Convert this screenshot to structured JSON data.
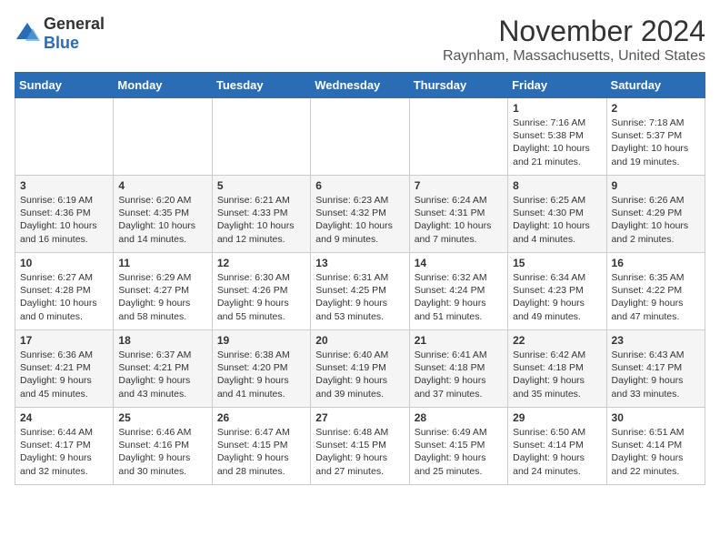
{
  "logo": {
    "general": "General",
    "blue": "Blue"
  },
  "header": {
    "month": "November 2024",
    "location": "Raynham, Massachusetts, United States"
  },
  "days_of_week": [
    "Sunday",
    "Monday",
    "Tuesday",
    "Wednesday",
    "Thursday",
    "Friday",
    "Saturday"
  ],
  "weeks": [
    [
      {
        "day": "",
        "info": ""
      },
      {
        "day": "",
        "info": ""
      },
      {
        "day": "",
        "info": ""
      },
      {
        "day": "",
        "info": ""
      },
      {
        "day": "",
        "info": ""
      },
      {
        "day": "1",
        "info": "Sunrise: 7:16 AM\nSunset: 5:38 PM\nDaylight: 10 hours and 21 minutes."
      },
      {
        "day": "2",
        "info": "Sunrise: 7:18 AM\nSunset: 5:37 PM\nDaylight: 10 hours and 19 minutes."
      }
    ],
    [
      {
        "day": "3",
        "info": "Sunrise: 6:19 AM\nSunset: 4:36 PM\nDaylight: 10 hours and 16 minutes."
      },
      {
        "day": "4",
        "info": "Sunrise: 6:20 AM\nSunset: 4:35 PM\nDaylight: 10 hours and 14 minutes."
      },
      {
        "day": "5",
        "info": "Sunrise: 6:21 AM\nSunset: 4:33 PM\nDaylight: 10 hours and 12 minutes."
      },
      {
        "day": "6",
        "info": "Sunrise: 6:23 AM\nSunset: 4:32 PM\nDaylight: 10 hours and 9 minutes."
      },
      {
        "day": "7",
        "info": "Sunrise: 6:24 AM\nSunset: 4:31 PM\nDaylight: 10 hours and 7 minutes."
      },
      {
        "day": "8",
        "info": "Sunrise: 6:25 AM\nSunset: 4:30 PM\nDaylight: 10 hours and 4 minutes."
      },
      {
        "day": "9",
        "info": "Sunrise: 6:26 AM\nSunset: 4:29 PM\nDaylight: 10 hours and 2 minutes."
      }
    ],
    [
      {
        "day": "10",
        "info": "Sunrise: 6:27 AM\nSunset: 4:28 PM\nDaylight: 10 hours and 0 minutes."
      },
      {
        "day": "11",
        "info": "Sunrise: 6:29 AM\nSunset: 4:27 PM\nDaylight: 9 hours and 58 minutes."
      },
      {
        "day": "12",
        "info": "Sunrise: 6:30 AM\nSunset: 4:26 PM\nDaylight: 9 hours and 55 minutes."
      },
      {
        "day": "13",
        "info": "Sunrise: 6:31 AM\nSunset: 4:25 PM\nDaylight: 9 hours and 53 minutes."
      },
      {
        "day": "14",
        "info": "Sunrise: 6:32 AM\nSunset: 4:24 PM\nDaylight: 9 hours and 51 minutes."
      },
      {
        "day": "15",
        "info": "Sunrise: 6:34 AM\nSunset: 4:23 PM\nDaylight: 9 hours and 49 minutes."
      },
      {
        "day": "16",
        "info": "Sunrise: 6:35 AM\nSunset: 4:22 PM\nDaylight: 9 hours and 47 minutes."
      }
    ],
    [
      {
        "day": "17",
        "info": "Sunrise: 6:36 AM\nSunset: 4:21 PM\nDaylight: 9 hours and 45 minutes."
      },
      {
        "day": "18",
        "info": "Sunrise: 6:37 AM\nSunset: 4:21 PM\nDaylight: 9 hours and 43 minutes."
      },
      {
        "day": "19",
        "info": "Sunrise: 6:38 AM\nSunset: 4:20 PM\nDaylight: 9 hours and 41 minutes."
      },
      {
        "day": "20",
        "info": "Sunrise: 6:40 AM\nSunset: 4:19 PM\nDaylight: 9 hours and 39 minutes."
      },
      {
        "day": "21",
        "info": "Sunrise: 6:41 AM\nSunset: 4:18 PM\nDaylight: 9 hours and 37 minutes."
      },
      {
        "day": "22",
        "info": "Sunrise: 6:42 AM\nSunset: 4:18 PM\nDaylight: 9 hours and 35 minutes."
      },
      {
        "day": "23",
        "info": "Sunrise: 6:43 AM\nSunset: 4:17 PM\nDaylight: 9 hours and 33 minutes."
      }
    ],
    [
      {
        "day": "24",
        "info": "Sunrise: 6:44 AM\nSunset: 4:17 PM\nDaylight: 9 hours and 32 minutes."
      },
      {
        "day": "25",
        "info": "Sunrise: 6:46 AM\nSunset: 4:16 PM\nDaylight: 9 hours and 30 minutes."
      },
      {
        "day": "26",
        "info": "Sunrise: 6:47 AM\nSunset: 4:15 PM\nDaylight: 9 hours and 28 minutes."
      },
      {
        "day": "27",
        "info": "Sunrise: 6:48 AM\nSunset: 4:15 PM\nDaylight: 9 hours and 27 minutes."
      },
      {
        "day": "28",
        "info": "Sunrise: 6:49 AM\nSunset: 4:15 PM\nDaylight: 9 hours and 25 minutes."
      },
      {
        "day": "29",
        "info": "Sunrise: 6:50 AM\nSunset: 4:14 PM\nDaylight: 9 hours and 24 minutes."
      },
      {
        "day": "30",
        "info": "Sunrise: 6:51 AM\nSunset: 4:14 PM\nDaylight: 9 hours and 22 minutes."
      }
    ]
  ]
}
